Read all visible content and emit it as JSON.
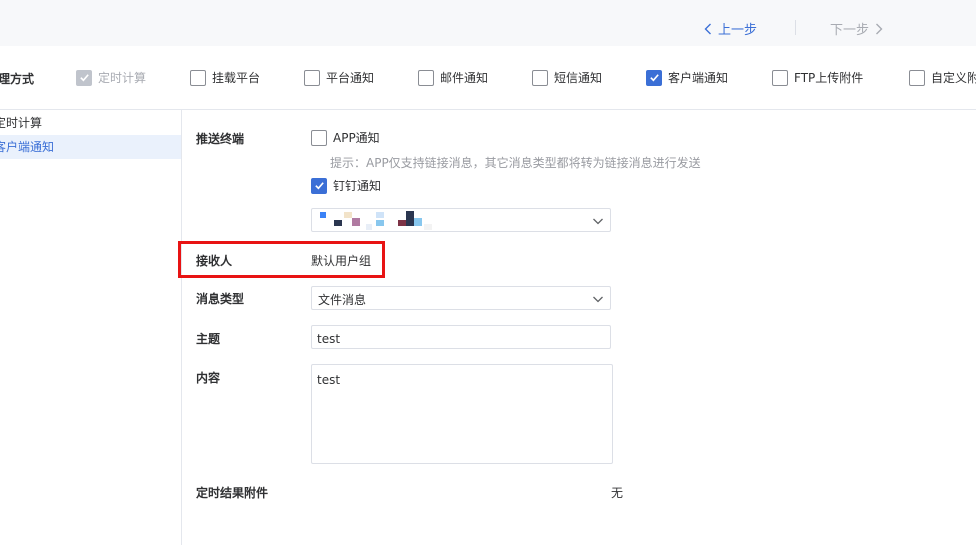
{
  "nav": {
    "prev_label": "上一步",
    "next_label": "下一步"
  },
  "tabs": {
    "title": "理方式",
    "options": [
      {
        "label": "定时计算",
        "checked": true,
        "disabled": true
      },
      {
        "label": "挂载平台",
        "checked": false
      },
      {
        "label": "平台通知",
        "checked": false
      },
      {
        "label": "邮件通知",
        "checked": false
      },
      {
        "label": "短信通知",
        "checked": false
      },
      {
        "label": "客户端通知",
        "checked": true
      },
      {
        "label": "FTP上传附件",
        "checked": false
      },
      {
        "label": "自定义附",
        "checked": false
      }
    ]
  },
  "sidebar": {
    "items": [
      {
        "label": "定时计算",
        "active": false
      },
      {
        "label": "客户端通知",
        "active": true
      }
    ]
  },
  "form": {
    "push_terminal_label": "推送终端",
    "app_notify_label": "APP通知",
    "app_notify_checked": false,
    "hint": "提示：APP仅支持链接消息，其它消息类型都将转为链接消息进行发送",
    "dingtalk_label": "钉钉通知",
    "dingtalk_checked": true,
    "receiver_label": "接收人",
    "receiver_value": "默认用户组",
    "msg_type_label": "消息类型",
    "msg_type_value": "文件消息",
    "subject_label": "主题",
    "subject_value": "test",
    "content_label": "内容",
    "content_value": "test",
    "attachment_label": "定时结果附件",
    "attachment_value": "无"
  },
  "colors": {
    "accent": "#3b6fd6",
    "highlight_border": "#e81313",
    "active_bg": "#eaf1fc"
  }
}
